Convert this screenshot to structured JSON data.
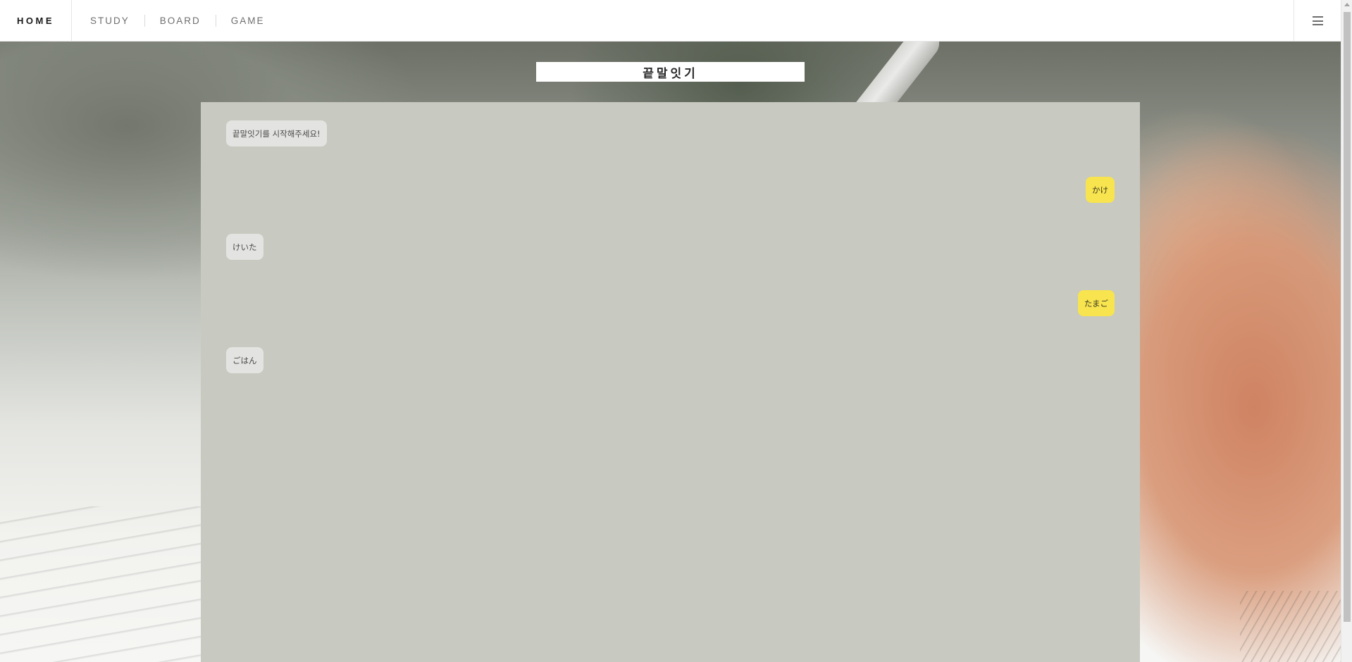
{
  "nav": {
    "brand": "HOME",
    "items": [
      {
        "label": "STUDY"
      },
      {
        "label": "BOARD"
      },
      {
        "label": "GAME"
      }
    ],
    "menu_icon": "hamburger-menu-icon"
  },
  "game": {
    "title": "끝말잇기"
  },
  "chat": {
    "messages": [
      {
        "sender": "bot",
        "text": "끝말잇기를 시작해주세요!"
      },
      {
        "sender": "user",
        "text": "かけ"
      },
      {
        "sender": "bot",
        "text": "けいた"
      },
      {
        "sender": "user",
        "text": "たまご"
      },
      {
        "sender": "bot",
        "text": "ごはん"
      }
    ]
  },
  "colors": {
    "chat_panel_bg": "#c8c9c0",
    "bot_bubble_bg": "#e3e3e1",
    "user_bubble_bg": "#f7e44f"
  }
}
